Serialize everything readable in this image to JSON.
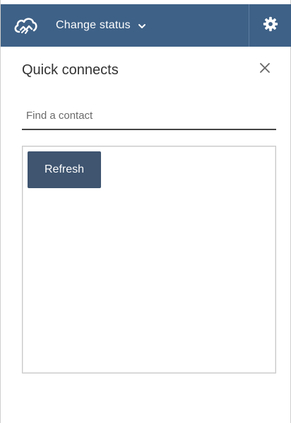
{
  "header": {
    "status_label": "Change status",
    "logo_icon": "cloud-handshake-icon",
    "settings_icon": "gear-icon",
    "bar_color": "#3e6187"
  },
  "panel": {
    "title": "Quick connects",
    "close_icon": "close-icon",
    "search_placeholder": "Find a contact",
    "search_value": "",
    "refresh_label": "Refresh",
    "refresh_color": "#3f5570"
  }
}
